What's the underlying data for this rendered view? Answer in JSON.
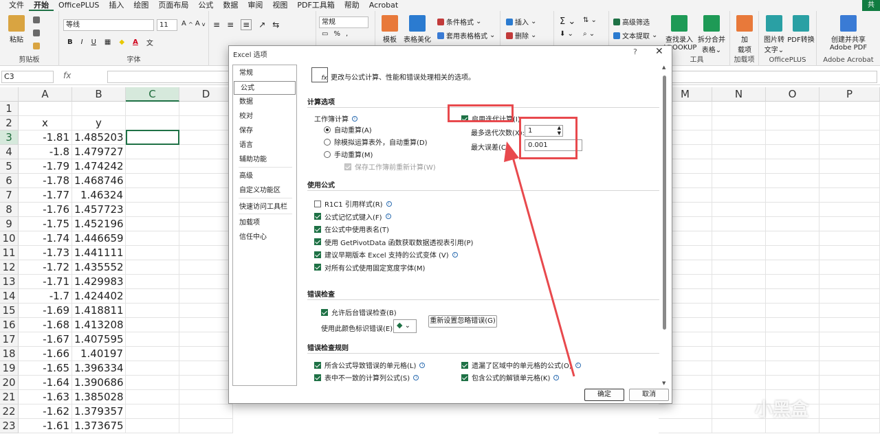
{
  "menu": {
    "items": [
      "文件",
      "开始",
      "OfficePLUS",
      "插入",
      "绘图",
      "页面布局",
      "公式",
      "数据",
      "审阅",
      "视图",
      "PDF工具箱",
      "帮助",
      "Acrobat"
    ],
    "active_index": 1,
    "share": "共"
  },
  "ribbon": {
    "clipboard": {
      "paste": "粘贴",
      "label": "剪贴板"
    },
    "font": {
      "name": "等线",
      "size": "11",
      "label": "字体"
    },
    "number": {
      "format": "常规"
    },
    "styles": {
      "cond_format": "条件格式",
      "table_format": "套用表格格式",
      "cell_style": "表格美化",
      "cell_style2": "模板"
    },
    "cells": {
      "insert": "插入",
      "delete": "删除"
    },
    "tools": {
      "adv_filter": "高级筛选",
      "text_extract": "文本提取"
    },
    "lookup": {
      "find": "查找录入",
      "vlookup": "VLOOKUP",
      "split": "拆分合并",
      "split2": "表格",
      "label": "工具"
    },
    "addins": {
      "btn": "加",
      "btn2": "载项",
      "label": "加载项"
    },
    "officeplus": {
      "img2text": "图片转",
      "img2text2": "文字",
      "pdf": "PDF转换",
      "label": "OfficePLUS"
    },
    "adobe": {
      "create": "创建并共享",
      "create2": "Adobe PDF",
      "label": "Adobe Acrobat"
    }
  },
  "formula_bar": {
    "name_box": "C3",
    "fx": "fx",
    "value": ""
  },
  "grid": {
    "columns": [
      "A",
      "B",
      "C",
      "D",
      "M",
      "N",
      "O",
      "P"
    ],
    "selected_column": "C",
    "selected_row": 3,
    "rows": [
      {
        "n": "1",
        "a": "",
        "b": ""
      },
      {
        "n": "2",
        "a": "x",
        "b": "y"
      },
      {
        "n": "3",
        "a": "-1.81",
        "b": "1.485203"
      },
      {
        "n": "4",
        "a": "-1.8",
        "b": "1.479727"
      },
      {
        "n": "5",
        "a": "-1.79",
        "b": "1.474242"
      },
      {
        "n": "6",
        "a": "-1.78",
        "b": "1.468746"
      },
      {
        "n": "7",
        "a": "-1.77",
        "b": "1.46324"
      },
      {
        "n": "8",
        "a": "-1.76",
        "b": "1.457723"
      },
      {
        "n": "9",
        "a": "-1.75",
        "b": "1.452196"
      },
      {
        "n": "10",
        "a": "-1.74",
        "b": "1.446659"
      },
      {
        "n": "11",
        "a": "-1.73",
        "b": "1.441111"
      },
      {
        "n": "12",
        "a": "-1.72",
        "b": "1.435552"
      },
      {
        "n": "13",
        "a": "-1.71",
        "b": "1.429983"
      },
      {
        "n": "14",
        "a": "-1.7",
        "b": "1.424402"
      },
      {
        "n": "15",
        "a": "-1.69",
        "b": "1.418811"
      },
      {
        "n": "16",
        "a": "-1.68",
        "b": "1.413208"
      },
      {
        "n": "17",
        "a": "-1.67",
        "b": "1.407595"
      },
      {
        "n": "18",
        "a": "-1.66",
        "b": "1.40197"
      },
      {
        "n": "19",
        "a": "-1.65",
        "b": "1.396334"
      },
      {
        "n": "20",
        "a": "-1.64",
        "b": "1.390686"
      },
      {
        "n": "21",
        "a": "-1.63",
        "b": "1.385028"
      },
      {
        "n": "22",
        "a": "-1.62",
        "b": "1.379357"
      },
      {
        "n": "23",
        "a": "-1.61",
        "b": "1.373675"
      }
    ]
  },
  "dialog": {
    "title": "Excel 选项",
    "help": "?",
    "close": "✕",
    "nav": [
      "常规",
      "公式",
      "数据",
      "校对",
      "保存",
      "语言",
      "辅助功能",
      "高级",
      "自定义功能区",
      "快速访问工具栏",
      "加载项",
      "信任中心"
    ],
    "active_nav": 1,
    "header": "更改与公式计算、性能和错误处理相关的选项。",
    "calc": {
      "section": "计算选项",
      "workbook_calc": "工作簿计算",
      "auto": "自动重算(A)",
      "auto_except": "除模拟运算表外，自动重算(D)",
      "manual": "手动重算(M)",
      "recalc_before_save": "保存工作簿前重新计算(W)",
      "enable_iter": "启用迭代计算(I)",
      "max_iter_label": "最多迭代次数(X):",
      "max_iter_value": "1",
      "max_change_label": "最大误差(C):",
      "max_change_value": "0.001"
    },
    "formulas": {
      "section": "使用公式",
      "items": [
        {
          "label": "R1C1 引用样式(R)",
          "checked": false,
          "info": true
        },
        {
          "label": "公式记忆式键入(F)",
          "checked": true,
          "info": true
        },
        {
          "label": "在公式中使用表名(T)",
          "checked": true,
          "info": false
        },
        {
          "label": "使用 GetPivotData 函数获取数据透视表引用(P)",
          "checked": true,
          "info": false
        },
        {
          "label": "建议早期版本 Excel 支持的公式变体 (V)",
          "checked": true,
          "info": true
        },
        {
          "label": "对所有公式使用固定宽度字体(M)",
          "checked": true,
          "info": false
        }
      ]
    },
    "errors": {
      "section": "错误检查",
      "bg_check": "允许后台错误检查(B)",
      "color_label": "使用此颜色标识错误(E):",
      "reset_btn": "重新设置忽略错误(G)"
    },
    "rules": {
      "section": "错误检查规则",
      "items": [
        {
          "label": "所含公式导致错误的单元格(L)",
          "checked": true
        },
        {
          "label": "遗漏了区域中的单元格的公式(O)",
          "checked": true
        },
        {
          "label": "表中不一致的计算列公式(S)",
          "checked": true
        },
        {
          "label": "包含公式的解锁单元格(K)",
          "checked": true
        }
      ]
    },
    "ok": "确定",
    "cancel": "取消"
  },
  "watermark": "小黑盒"
}
